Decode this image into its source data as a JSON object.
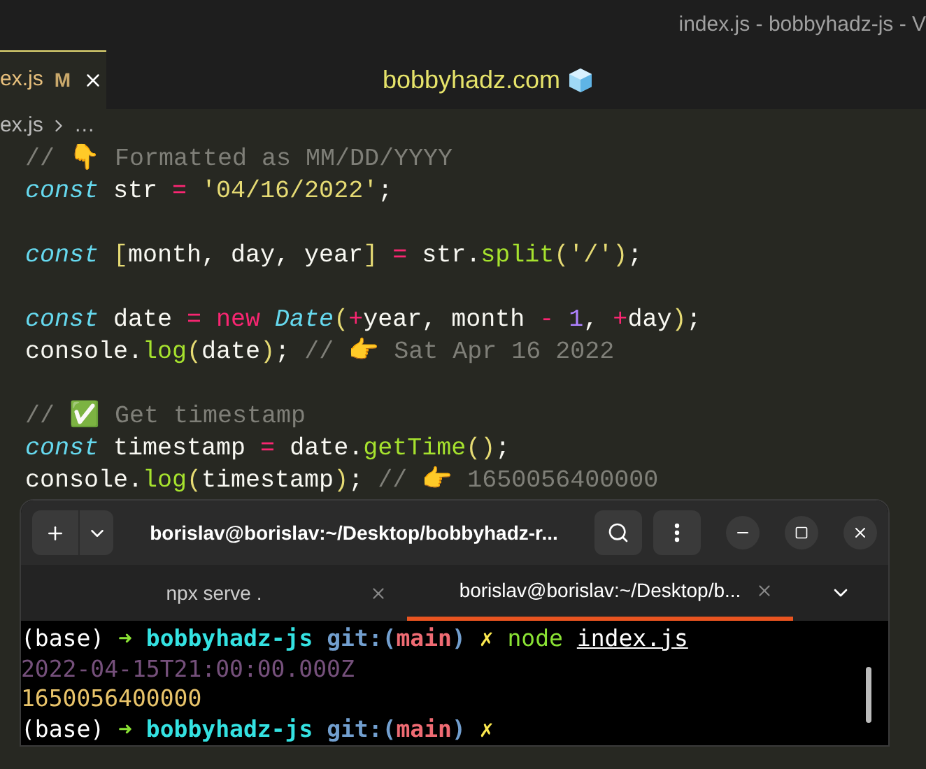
{
  "window": {
    "title": "index.js - bobbyhadz-js - V"
  },
  "editor_tab": {
    "label": "ex.js",
    "badge": "M"
  },
  "site_banner": {
    "text": "bobbyhadz.com"
  },
  "breadcrumb": [
    "ex.js",
    "…"
  ],
  "code_blocks": [
    [
      [
        {
          "text": "// 👇 Formatted as MM/DD/YYYY",
          "kind": "comment"
        }
      ],
      [
        {
          "text": "const",
          "kind": "keyword"
        },
        {
          "text": " str ",
          "kind": "plain"
        },
        {
          "text": "=",
          "kind": "operator"
        },
        {
          "text": " '04/16/2022'",
          "kind": "string"
        },
        {
          "text": ";",
          "kind": "plain"
        }
      ]
    ],
    [
      [
        {
          "text": "const",
          "kind": "keyword"
        },
        {
          "text": " [",
          "kind": "bracket"
        },
        {
          "text": "month, day, year",
          "kind": "plain"
        },
        {
          "text": "] ",
          "kind": "bracket"
        },
        {
          "text": "=",
          "kind": "operator"
        },
        {
          "text": " str.",
          "kind": "plain"
        },
        {
          "text": "split",
          "kind": "function"
        },
        {
          "text": "(",
          "kind": "bracket"
        },
        {
          "text": "'/'",
          "kind": "string"
        },
        {
          "text": ")",
          "kind": "bracket"
        },
        {
          "text": ";",
          "kind": "plain"
        }
      ]
    ],
    [
      [
        {
          "text": "const",
          "kind": "keyword"
        },
        {
          "text": " date ",
          "kind": "plain"
        },
        {
          "text": "= new",
          "kind": "operator"
        },
        {
          "text": " Date",
          "kind": "keyword"
        },
        {
          "text": "(",
          "kind": "bracket"
        },
        {
          "text": "+",
          "kind": "operator"
        },
        {
          "text": "year, month ",
          "kind": "plain"
        },
        {
          "text": "- ",
          "kind": "operator"
        },
        {
          "text": "1",
          "kind": "number"
        },
        {
          "text": ", ",
          "kind": "plain"
        },
        {
          "text": "+",
          "kind": "operator"
        },
        {
          "text": "day",
          "kind": "plain"
        },
        {
          "text": ")",
          "kind": "bracket"
        },
        {
          "text": ";",
          "kind": "plain"
        }
      ],
      [
        {
          "text": "console.",
          "kind": "plain"
        },
        {
          "text": "log",
          "kind": "function"
        },
        {
          "text": "(",
          "kind": "bracket"
        },
        {
          "text": "date",
          "kind": "plain"
        },
        {
          "text": ")",
          "kind": "bracket"
        },
        {
          "text": "; ",
          "kind": "plain"
        },
        {
          "text": "// 👉 Sat Apr 16 2022",
          "kind": "comment"
        }
      ]
    ],
    [
      [
        {
          "text": "// ✅ Get timestamp",
          "kind": "comment"
        }
      ],
      [
        {
          "text": "const",
          "kind": "keyword"
        },
        {
          "text": " timestamp ",
          "kind": "plain"
        },
        {
          "text": "=",
          "kind": "operator"
        },
        {
          "text": " date.",
          "kind": "plain"
        },
        {
          "text": "getTime",
          "kind": "function"
        },
        {
          "text": "()",
          "kind": "bracket"
        },
        {
          "text": ";",
          "kind": "plain"
        }
      ],
      [
        {
          "text": "console.",
          "kind": "plain"
        },
        {
          "text": "log",
          "kind": "function"
        },
        {
          "text": "(",
          "kind": "bracket"
        },
        {
          "text": "timestamp",
          "kind": "plain"
        },
        {
          "text": ")",
          "kind": "bracket"
        },
        {
          "text": "; ",
          "kind": "plain"
        },
        {
          "text": "// 👉 1650056400000",
          "kind": "comment"
        }
      ]
    ]
  ],
  "terminal": {
    "title": "borislav@borislav:~/Desktop/bobbyhadz-r...",
    "tabs": [
      {
        "label": "npx serve .",
        "selected": false
      },
      {
        "label": "borislav@borislav:~/Desktop/b...",
        "selected": true
      }
    ],
    "lines": [
      [
        {
          "text": "(base) ",
          "kind": "plain"
        },
        {
          "text": "➜ ",
          "kind": "arrow"
        },
        {
          "text": "bobbyhadz-js ",
          "kind": "dir"
        },
        {
          "text": "git:(",
          "kind": "git"
        },
        {
          "text": "main",
          "kind": "branch"
        },
        {
          "text": ") ",
          "kind": "git"
        },
        {
          "text": "✗ ",
          "kind": "dirty"
        },
        {
          "text": "node ",
          "kind": "command"
        },
        {
          "text": "index.js",
          "kind": "path"
        }
      ],
      [
        {
          "text": "2022-04-15T21:00:00.000Z",
          "kind": "date"
        }
      ],
      [
        {
          "text": "1650056400000",
          "kind": "number"
        }
      ],
      [
        {
          "text": "(base) ",
          "kind": "plain"
        },
        {
          "text": "➜ ",
          "kind": "arrow"
        },
        {
          "text": "bobbyhadz-js ",
          "kind": "dir"
        },
        {
          "text": "git:(",
          "kind": "git"
        },
        {
          "text": "main",
          "kind": "branch"
        },
        {
          "text": ") ",
          "kind": "git"
        },
        {
          "text": "✗",
          "kind": "dirty"
        }
      ]
    ]
  }
}
